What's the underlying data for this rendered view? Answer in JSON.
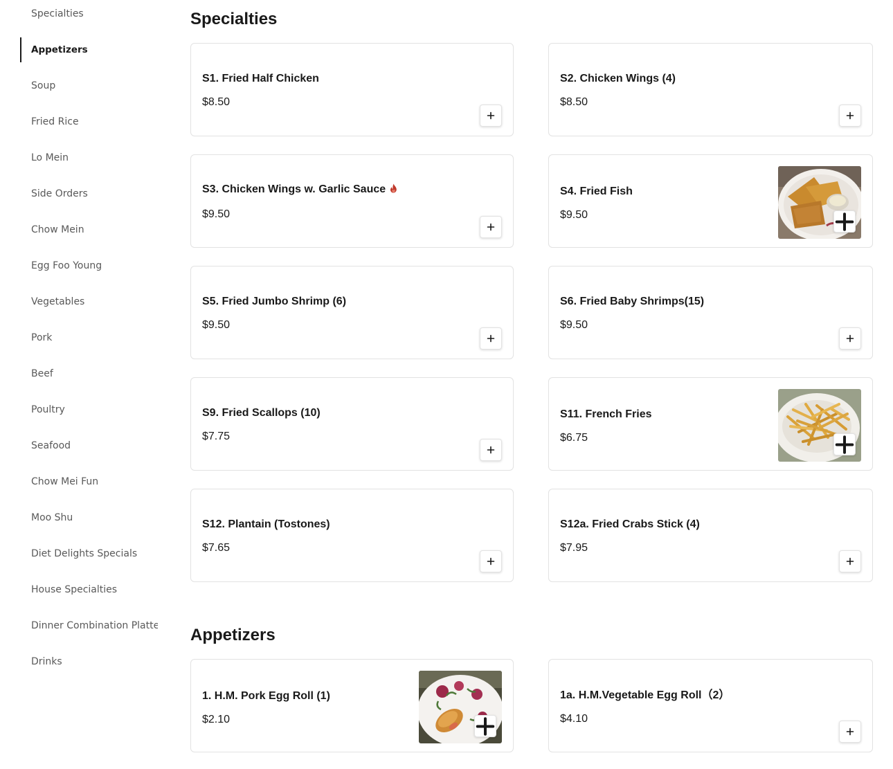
{
  "sidebar": {
    "items": [
      {
        "label": "Specialties"
      },
      {
        "label": "Appetizers"
      },
      {
        "label": "Soup"
      },
      {
        "label": "Fried Rice"
      },
      {
        "label": "Lo Mein"
      },
      {
        "label": "Side Orders"
      },
      {
        "label": "Chow Mein"
      },
      {
        "label": "Egg Foo Young"
      },
      {
        "label": "Vegetables"
      },
      {
        "label": "Pork"
      },
      {
        "label": "Beef"
      },
      {
        "label": "Poultry"
      },
      {
        "label": "Seafood"
      },
      {
        "label": "Chow Mei Fun"
      },
      {
        "label": "Moo Shu"
      },
      {
        "label": "Diet Delights Specials"
      },
      {
        "label": "House Specialties"
      },
      {
        "label": "Dinner Combination Platters"
      },
      {
        "label": "Drinks"
      }
    ],
    "active_item": "Appetizers"
  },
  "sections": [
    {
      "title": "Specialties",
      "items": [
        {
          "name": "S1. Fried Half Chicken",
          "price": "$8.50"
        },
        {
          "name": "S2. Chicken Wings (4)",
          "price": "$8.50"
        },
        {
          "name": "S3. Chicken Wings w. Garlic Sauce",
          "price": "$9.50",
          "icon": "spicy-icon"
        },
        {
          "name": "S4. Fried Fish",
          "price": "$9.50",
          "image": "fried-fish-photo"
        },
        {
          "name": "S5. Fried Jumbo Shrimp (6)",
          "price": "$9.50"
        },
        {
          "name": "S6. Fried Baby Shrimps(15)",
          "price": "$9.50"
        },
        {
          "name": "S9. Fried Scallops (10)",
          "price": "$7.75"
        },
        {
          "name": "S11. French Fries",
          "price": "$6.75",
          "image": "french-fries-photo"
        },
        {
          "name": "S12. Plantain (Tostones)",
          "price": "$7.65"
        },
        {
          "name": "S12a. Fried Crabs Stick (4)",
          "price": "$7.95"
        }
      ]
    },
    {
      "title": "Appetizers",
      "items": [
        {
          "name": "1. H.M. Pork Egg Roll (1)",
          "price": "$2.10",
          "image": "egg-roll-photo"
        },
        {
          "name": "1a. H.M.Vegetable Egg Roll（2）",
          "price": "$4.10"
        }
      ]
    }
  ],
  "colors": {
    "text": "#191919",
    "muted": "#595959",
    "border": "#e2e2e2",
    "spicy": "#c0392b"
  },
  "icons": {
    "add": "plus-icon",
    "spicy": "spicy-icon"
  }
}
